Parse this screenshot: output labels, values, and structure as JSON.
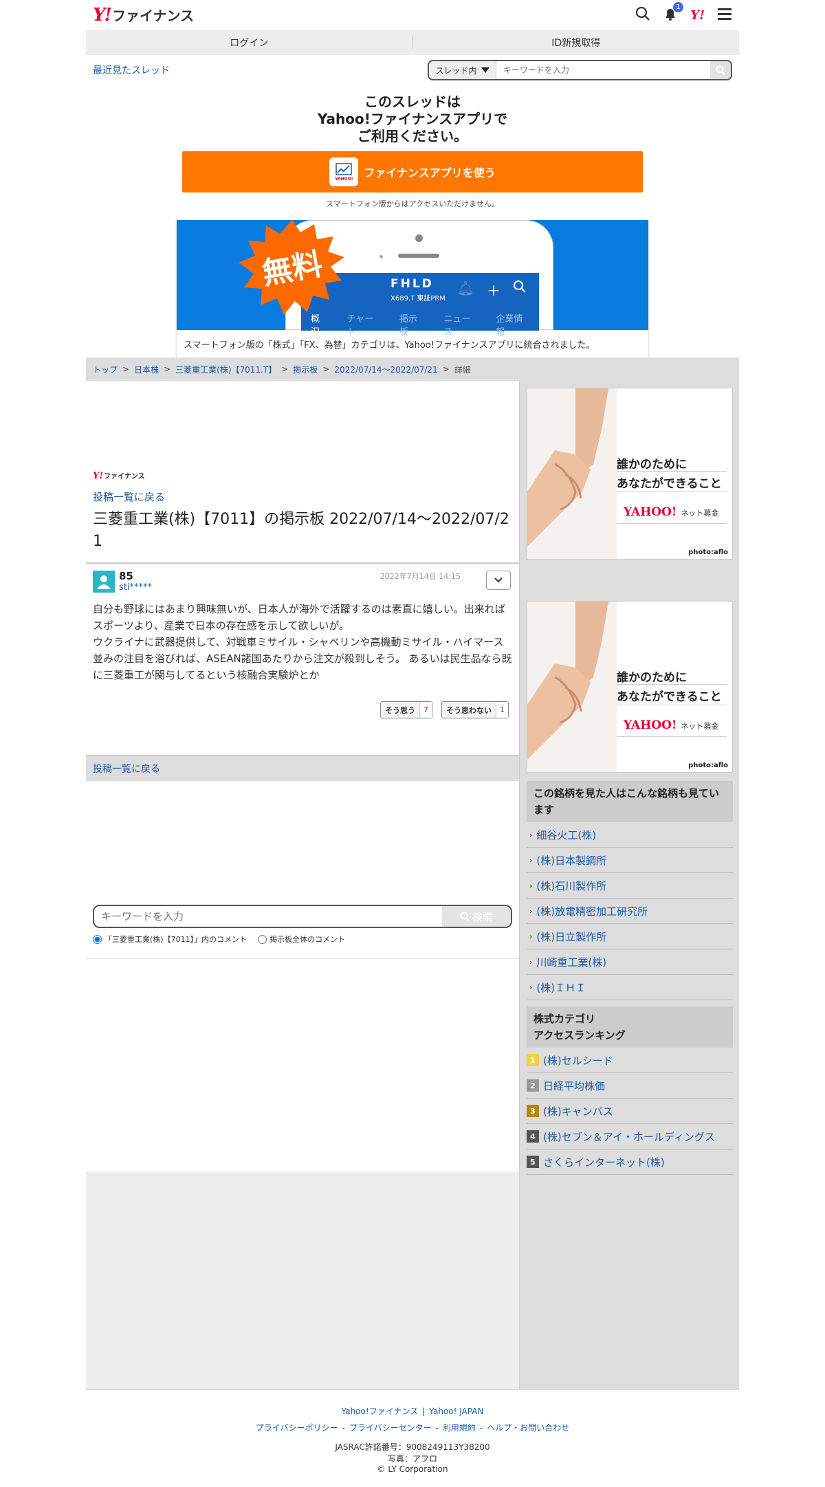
{
  "header": {
    "logo_mark": "Y!",
    "logo_text": "ファイナンス",
    "notification_count": "1",
    "yahoo_mark": "Y!"
  },
  "login_bar": {
    "login": "ログイン",
    "signup": "ID新規取得"
  },
  "recent": {
    "link": "最近見たスレッド",
    "search_scope": "スレッド内",
    "search_placeholder": "キーワードを入力"
  },
  "promo": {
    "title_line1": "このスレッドは",
    "title_line2": "Yahoo!ファイナンスアプリで",
    "title_line3": "ご利用ください。",
    "button_label": "ファイナンスアプリを使う",
    "note": "スマートフォン版からはアクセスいただけません。"
  },
  "banner": {
    "badge": "無料",
    "ticker": "FHLD",
    "ticker_sub": "X689.T 東証PRM",
    "tabs": [
      "概況",
      "チャート",
      "掲示板",
      "ニュース",
      "企業情報"
    ],
    "caption": "スマートフォン版の「株式」「FX、為替」カテゴリは、Yahoo!ファイナンスアプリに統合されました。"
  },
  "breadcrumb": {
    "items": [
      "トップ",
      "日本株",
      "三菱重工業(株)【7011.T】",
      "掲示板",
      "2022/07/14〜2022/07/21"
    ],
    "current": "詳細"
  },
  "thread": {
    "mini_logo_mark": "Y!",
    "mini_logo_text": "ファイナンス",
    "back_link": "投稿一覧に戻る",
    "title": "三菱重工業(株)【7011】の掲示板 2022/07/14〜2022/07/21"
  },
  "post": {
    "number": "85",
    "user": "sti*****",
    "date": "2022年7月14日 14:15",
    "body_line1": "自分も野球にはあまり興味無いが、日本人が海外で活躍するのは素直に嬉しい。出来ればスポーツより、産業で日本の存在感を示して欲しいが。",
    "body_line2": "ウクライナに武器提供して、対戦車ミサイル・シャベリンや高機動ミサイル・ハイマース並みの注目を浴びれば、ASEAN諸国あたりから注文が殺到しそう。 あるいは民生品なら既に三菱重工が関与してるという核融合実験炉とか",
    "agree_label": "そう思う",
    "agree_count": "7",
    "disagree_label": "そう思わない",
    "disagree_count": "1"
  },
  "back_bar": "投稿一覧に戻る",
  "bottom_search": {
    "placeholder": "キーワードを入力",
    "button": "検索",
    "radio1": "「三菱重工業(株)【7011】」内のコメント",
    "radio2": "掲示板全体のコメント"
  },
  "ads": {
    "line1": "誰かのために",
    "line2": "あなたができること",
    "brand": "YAHOO!",
    "brand_sub": "ネット募金",
    "credit": "photo:aflo"
  },
  "related": {
    "heading": "この銘柄を見た人はこんな銘柄も見ています",
    "items": [
      "細谷火工(株)",
      "(株)日本製鋼所",
      "(株)石川製作所",
      "(株)放電精密加工研究所",
      "(株)日立製作所",
      "川崎重工業(株)",
      "(株)ＩＨＩ"
    ]
  },
  "ranking": {
    "heading_line1": "株式カテゴリ",
    "heading_line2": "アクセスランキング",
    "items": [
      {
        "rank": "1",
        "name": "(株)セルシード",
        "color": "#f4d03f"
      },
      {
        "rank": "2",
        "name": "日経平均株価",
        "color": "#999999"
      },
      {
        "rank": "3",
        "name": "(株)キャンバス",
        "color": "#b8860b"
      },
      {
        "rank": "4",
        "name": "(株)セブン＆アイ・ホールディングス",
        "color": "#555555"
      },
      {
        "rank": "5",
        "name": "さくらインターネット(株)",
        "color": "#555555"
      }
    ]
  },
  "footer": {
    "links1": [
      "Yahoo!ファイナンス",
      "Yahoo! JAPAN"
    ],
    "links2": [
      "プライバシーポリシー",
      "プライバシーセンター",
      "利用規約",
      "ヘルプ・お問い合わせ"
    ],
    "jasrac": "JASRAC許諾番号：9008249113Y38200",
    "photo": "写真：アフロ",
    "copyright": "© LY Corporation"
  }
}
